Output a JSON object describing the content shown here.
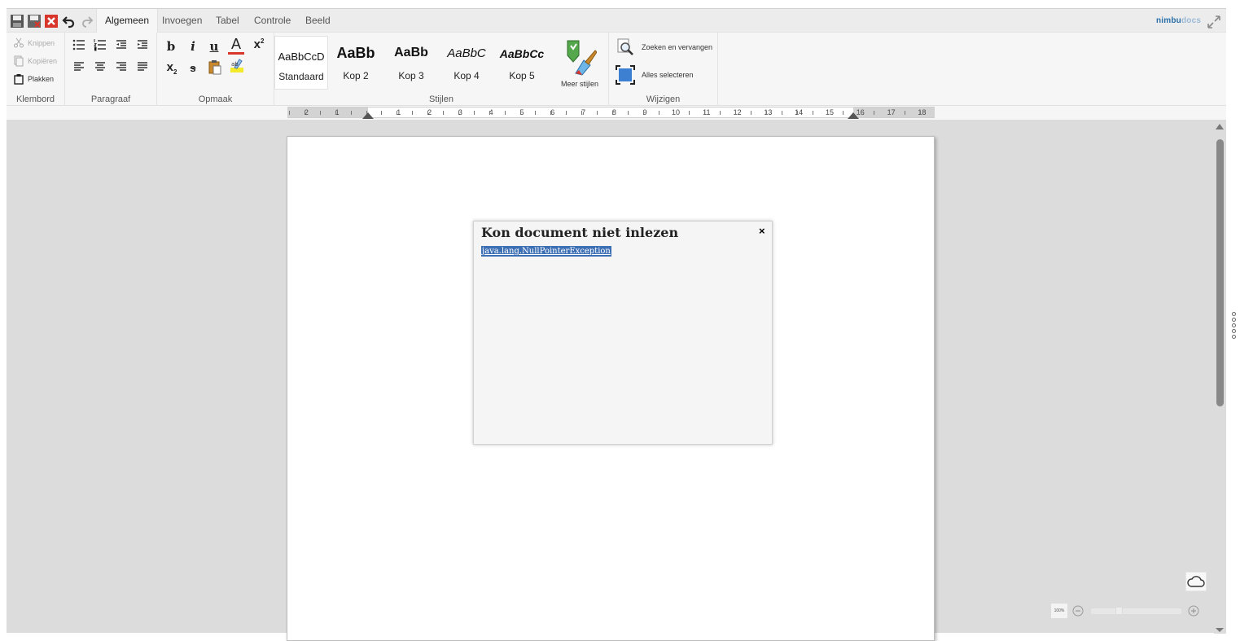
{
  "tabs": [
    {
      "label": "Algemeen",
      "active": true
    },
    {
      "label": "Invoegen"
    },
    {
      "label": "Tabel"
    },
    {
      "label": "Controle"
    },
    {
      "label": "Beeld"
    }
  ],
  "brand": {
    "part1": "nimbu",
    "part2": "docs"
  },
  "clipboard": {
    "cut": "Knippen",
    "copy": "Kopiëren",
    "paste": "Plakken",
    "label": "Klembord"
  },
  "paragraph": {
    "label": "Paragraaf"
  },
  "format": {
    "label": "Opmaak",
    "bold": "b",
    "italic": "i",
    "underline": "u",
    "font_color": "A",
    "superscript_base": "x",
    "superscript_mark": "2",
    "subscript_base": "x",
    "subscript_mark": "2",
    "strikethrough": "s"
  },
  "styles": {
    "label": "Stijlen",
    "items": [
      {
        "preview": "AaBbCcD",
        "name": "Standaard"
      },
      {
        "preview": "AaBb",
        "name": "Kop 2"
      },
      {
        "preview": "AaBb",
        "name": "Kop 3"
      },
      {
        "preview": "AaBbC",
        "name": "Kop 4"
      },
      {
        "preview": "AaBbCc",
        "name": "Kop 5"
      }
    ],
    "more": "Meer stijlen"
  },
  "edit": {
    "label": "Wijzigen",
    "find_replace": "Zoeken en vervangen",
    "select_all": "Alles selecteren"
  },
  "ruler": {
    "numbers_left": [
      "2",
      "1"
    ],
    "numbers_right": [
      "1",
      "2",
      "3",
      "4",
      "5",
      "6",
      "7",
      "8",
      "9",
      "10",
      "11",
      "12",
      "13",
      "14",
      "15",
      "16",
      "17",
      "18"
    ]
  },
  "dialog": {
    "title": "Kon document niet inlezen",
    "message": "java.lang.NullPointerException",
    "close": "×"
  },
  "zoom": {
    "level": "100%"
  },
  "colors": {
    "accent_red": "#d8362a",
    "brand_blue": "#2a6fa8",
    "selection": "#3d6fb4"
  }
}
